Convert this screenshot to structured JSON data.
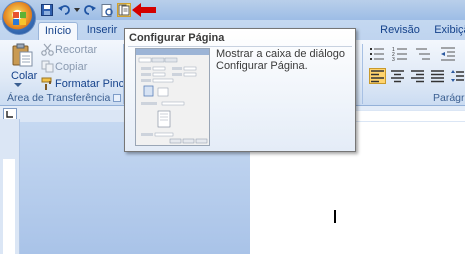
{
  "quick_access": {
    "icons": [
      "save-icon",
      "undo-icon",
      "redo-icon",
      "print-preview-icon",
      "page-setup-icon"
    ]
  },
  "tabs": [
    {
      "label": "Início",
      "active": true
    },
    {
      "label": "Inserir",
      "active": false
    },
    {
      "label": "Revisão",
      "active": false
    },
    {
      "label": "Exibição",
      "active": false
    }
  ],
  "clipboard": {
    "paste_label": "Colar",
    "cut_label": "Recortar",
    "copy_label": "Copiar",
    "format_painter_label": "Formatar Pincel",
    "group_title": "Área de Transferência"
  },
  "paragraph": {
    "group_title": "Parágrafo"
  },
  "tooltip": {
    "title": "Configurar Página",
    "description": "Mostrar a caixa de diálogo Configurar Página."
  },
  "colors": {
    "highlight_arrow": "#d40000",
    "active_align": "#ffd46e"
  }
}
